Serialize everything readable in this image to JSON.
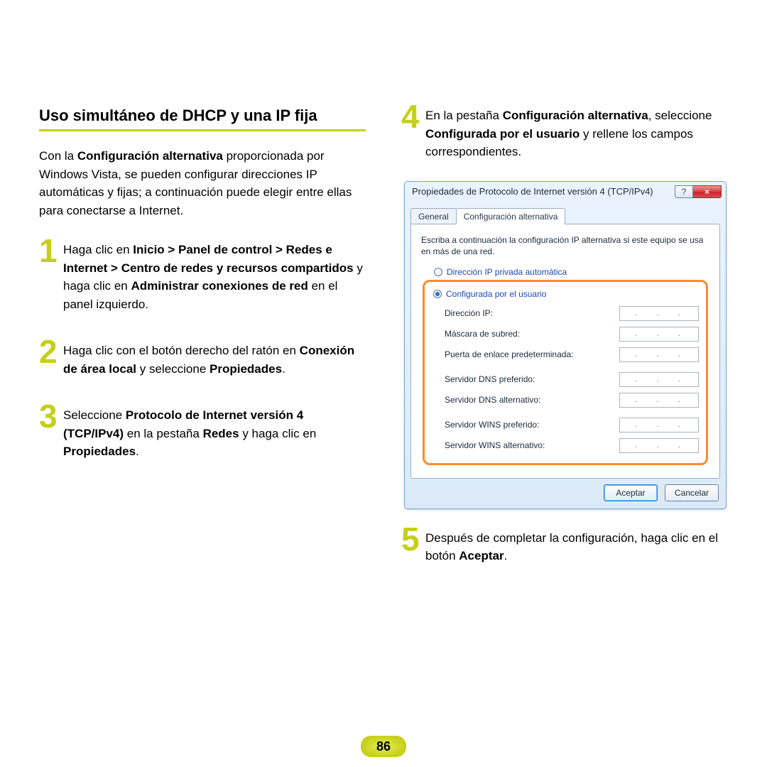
{
  "page_number": "86",
  "heading": "Uso simultáneo de DHCP y una IP fija",
  "intro": {
    "pre": "Con la ",
    "b1": "Configuración alternativa",
    "post": " proporcionada por Windows Vista, se pueden configurar direcciones IP automáticas y fijas; a continuación puede elegir entre ellas para conectarse a Internet."
  },
  "steps": {
    "s1": {
      "num": "1",
      "t1": "Haga clic en ",
      "b1": "Inicio > Panel de control > Redes e Internet > Centro de redes y recursos compartidos",
      "t2": " y haga clic en ",
      "b2": "Administrar conexiones de red",
      "t3": " en el panel izquierdo."
    },
    "s2": {
      "num": "2",
      "t1": "Haga clic con el botón derecho del ratón en ",
      "b1": "Conexión de área local",
      "t2": " y seleccione ",
      "b2": "Propiedades",
      "t3": "."
    },
    "s3": {
      "num": "3",
      "t1": "Seleccione ",
      "b1": "Protocolo de Internet versión 4 (TCP/IPv4)",
      "t2": " en la pestaña ",
      "b2": "Redes",
      "t3": " y haga clic en ",
      "b3": "Propiedades",
      "t4": "."
    },
    "s4": {
      "num": "4",
      "t1": "En la pestaña ",
      "b1": "Configuración alternativa",
      "t2": ", seleccione ",
      "b2": "Configurada por el usuario",
      "t3": " y rellene los campos correspondientes."
    },
    "s5": {
      "num": "5",
      "t1": "Después de completar la configuración, haga clic en el botón ",
      "b1": "Aceptar",
      "t2": "."
    }
  },
  "dialog": {
    "title": "Propiedades de Protocolo de Internet versión 4 (TCP/IPv4)",
    "help_glyph": "?",
    "close_glyph": "×",
    "tabs": {
      "general": "General",
      "alt": "Configuración alternativa"
    },
    "desc": "Escriba a continuación la configuración IP alternativa si este equipo se usa en más de una red.",
    "radio_auto": "Dirección IP privada automática",
    "radio_user": "Configurada por el usuario",
    "fields": {
      "ip": "Dirección IP:",
      "mask": "Máscara de subred:",
      "gw": "Puerta de enlace predeterminada:",
      "dns1": "Servidor DNS preferido:",
      "dns2": "Servidor DNS alternativo:",
      "wins1": "Servidor WINS preferido:",
      "wins2": "Servidor WINS alternativo:"
    },
    "dot": ".",
    "ok": "Aceptar",
    "cancel": "Cancelar"
  }
}
